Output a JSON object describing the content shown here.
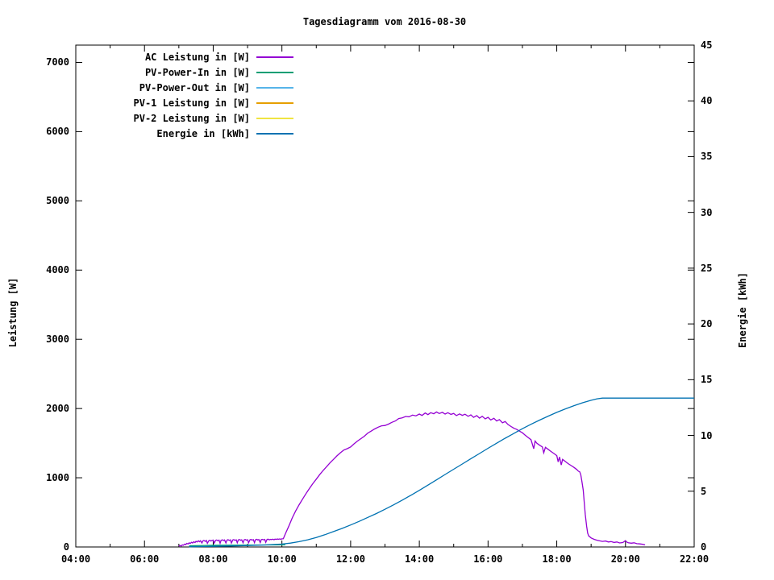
{
  "chart_data": {
    "type": "line",
    "title": "Tagesdiagramm vom 2016-08-30",
    "y1_label": "Leistung [W]",
    "y2_label": "Energie [kWh]",
    "x_range": [
      4,
      22
    ],
    "y1_range": [
      0,
      7250
    ],
    "y2_range": [
      0,
      45
    ],
    "grid": false,
    "legend_position": "top-left-inside",
    "x_ticks": [
      {
        "value": 4,
        "label": "04:00"
      },
      {
        "value": 6,
        "label": "06:00"
      },
      {
        "value": 8,
        "label": "08:00"
      },
      {
        "value": 10,
        "label": "10:00"
      },
      {
        "value": 12,
        "label": "12:00"
      },
      {
        "value": 14,
        "label": "14:00"
      },
      {
        "value": 16,
        "label": "16:00"
      },
      {
        "value": 18,
        "label": "18:00"
      },
      {
        "value": 20,
        "label": "20:00"
      },
      {
        "value": 22,
        "label": "22:00"
      }
    ],
    "x_minor_ticks": [
      5,
      7,
      9,
      11,
      13,
      15,
      17,
      19,
      21
    ],
    "y1_ticks": [
      {
        "value": 0,
        "label": "0"
      },
      {
        "value": 1000,
        "label": "1000"
      },
      {
        "value": 2000,
        "label": "2000"
      },
      {
        "value": 3000,
        "label": "3000"
      },
      {
        "value": 4000,
        "label": "4000"
      },
      {
        "value": 5000,
        "label": "5000"
      },
      {
        "value": 6000,
        "label": "6000"
      },
      {
        "value": 7000,
        "label": "7000"
      }
    ],
    "y2_ticks": [
      {
        "value": 0,
        "label": "0"
      },
      {
        "value": 5,
        "label": "5"
      },
      {
        "value": 10,
        "label": "10"
      },
      {
        "value": 15,
        "label": "15"
      },
      {
        "value": 20,
        "label": "20"
      },
      {
        "value": 25,
        "label": "25"
      },
      {
        "value": 30,
        "label": "30"
      },
      {
        "value": 35,
        "label": "35"
      },
      {
        "value": 40,
        "label": "40"
      },
      {
        "value": 45,
        "label": "45"
      }
    ],
    "series": [
      {
        "name": "ac-leistung",
        "label": "AC Leistung in [W]",
        "color": "#9400d3",
        "axis": "y1",
        "points": [
          [
            7.0,
            10
          ],
          [
            7.03,
            22
          ],
          [
            7.07,
            14
          ],
          [
            7.1,
            30
          ],
          [
            7.13,
            24
          ],
          [
            7.17,
            42
          ],
          [
            7.2,
            34
          ],
          [
            7.23,
            52
          ],
          [
            7.27,
            44
          ],
          [
            7.3,
            60
          ],
          [
            7.33,
            50
          ],
          [
            7.37,
            68
          ],
          [
            7.4,
            58
          ],
          [
            7.43,
            74
          ],
          [
            7.47,
            64
          ],
          [
            7.5,
            82
          ],
          [
            7.53,
            72
          ],
          [
            7.57,
            88
          ],
          [
            7.6,
            76
          ],
          [
            7.63,
            90
          ],
          [
            7.67,
            58
          ],
          [
            7.7,
            88
          ],
          [
            7.73,
            94
          ],
          [
            7.77,
            80
          ],
          [
            7.8,
            94
          ],
          [
            7.83,
            54
          ],
          [
            7.87,
            90
          ],
          [
            7.9,
            98
          ],
          [
            7.93,
            86
          ],
          [
            7.97,
            94
          ],
          [
            8.0,
            99
          ],
          [
            8.03,
            56
          ],
          [
            8.07,
            95
          ],
          [
            8.1,
            101
          ],
          [
            8.13,
            91
          ],
          [
            8.17,
            99
          ],
          [
            8.2,
            54
          ],
          [
            8.23,
            97
          ],
          [
            8.27,
            103
          ],
          [
            8.3,
            93
          ],
          [
            8.33,
            101
          ],
          [
            8.37,
            58
          ],
          [
            8.4,
            99
          ],
          [
            8.43,
            105
          ],
          [
            8.47,
            95
          ],
          [
            8.5,
            102
          ],
          [
            8.53,
            57
          ],
          [
            8.57,
            101
          ],
          [
            8.6,
            106
          ],
          [
            8.63,
            96
          ],
          [
            8.67,
            103
          ],
          [
            8.7,
            60
          ],
          [
            8.73,
            102
          ],
          [
            8.77,
            107
          ],
          [
            8.8,
            97
          ],
          [
            8.83,
            104
          ],
          [
            8.87,
            59
          ],
          [
            8.9,
            103
          ],
          [
            8.93,
            108
          ],
          [
            8.97,
            98
          ],
          [
            9.0,
            105
          ],
          [
            9.03,
            61
          ],
          [
            9.07,
            104
          ],
          [
            9.1,
            109
          ],
          [
            9.13,
            99
          ],
          [
            9.17,
            106
          ],
          [
            9.2,
            63
          ],
          [
            9.23,
            105
          ],
          [
            9.27,
            110
          ],
          [
            9.3,
            100
          ],
          [
            9.33,
            107
          ],
          [
            9.37,
            64
          ],
          [
            9.4,
            107
          ],
          [
            9.43,
            111
          ],
          [
            9.47,
            102
          ],
          [
            9.5,
            109
          ],
          [
            9.53,
            67
          ],
          [
            9.57,
            109
          ],
          [
            9.6,
            113
          ],
          [
            9.63,
            104
          ],
          [
            9.67,
            111
          ],
          [
            9.7,
            107
          ],
          [
            9.73,
            113
          ],
          [
            9.77,
            105
          ],
          [
            9.8,
            114
          ],
          [
            9.83,
            109
          ],
          [
            9.87,
            115
          ],
          [
            9.9,
            111
          ],
          [
            9.93,
            116
          ],
          [
            9.97,
            112
          ],
          [
            10.0,
            117
          ],
          [
            10.04,
            119
          ],
          [
            10.1,
            190
          ],
          [
            10.2,
            300
          ],
          [
            10.3,
            420
          ],
          [
            10.4,
            520
          ],
          [
            10.5,
            610
          ],
          [
            10.6,
            690
          ],
          [
            10.7,
            770
          ],
          [
            10.8,
            845
          ],
          [
            10.9,
            915
          ],
          [
            11.0,
            980
          ],
          [
            11.1,
            1045
          ],
          [
            11.2,
            1105
          ],
          [
            11.3,
            1160
          ],
          [
            11.4,
            1215
          ],
          [
            11.5,
            1265
          ],
          [
            11.6,
            1315
          ],
          [
            11.7,
            1360
          ],
          [
            11.8,
            1400
          ],
          [
            11.9,
            1420
          ],
          [
            12.0,
            1445
          ],
          [
            12.1,
            1490
          ],
          [
            12.2,
            1530
          ],
          [
            12.3,
            1565
          ],
          [
            12.4,
            1600
          ],
          [
            12.5,
            1645
          ],
          [
            12.6,
            1675
          ],
          [
            12.7,
            1705
          ],
          [
            12.8,
            1730
          ],
          [
            12.9,
            1750
          ],
          [
            13.0,
            1755
          ],
          [
            13.1,
            1775
          ],
          [
            13.2,
            1800
          ],
          [
            13.3,
            1820
          ],
          [
            13.4,
            1855
          ],
          [
            13.5,
            1865
          ],
          [
            13.6,
            1885
          ],
          [
            13.7,
            1880
          ],
          [
            13.8,
            1905
          ],
          [
            13.9,
            1895
          ],
          [
            14.0,
            1920
          ],
          [
            14.08,
            1900
          ],
          [
            14.17,
            1935
          ],
          [
            14.25,
            1912
          ],
          [
            14.33,
            1940
          ],
          [
            14.42,
            1925
          ],
          [
            14.5,
            1950
          ],
          [
            14.58,
            1928
          ],
          [
            14.67,
            1945
          ],
          [
            14.75,
            1920
          ],
          [
            14.83,
            1940
          ],
          [
            14.92,
            1915
          ],
          [
            15.0,
            1930
          ],
          [
            15.08,
            1898
          ],
          [
            15.17,
            1922
          ],
          [
            15.25,
            1902
          ],
          [
            15.33,
            1918
          ],
          [
            15.42,
            1888
          ],
          [
            15.5,
            1908
          ],
          [
            15.58,
            1872
          ],
          [
            15.67,
            1898
          ],
          [
            15.75,
            1862
          ],
          [
            15.83,
            1888
          ],
          [
            15.92,
            1850
          ],
          [
            16.0,
            1872
          ],
          [
            16.08,
            1835
          ],
          [
            16.17,
            1858
          ],
          [
            16.25,
            1820
          ],
          [
            16.33,
            1840
          ],
          [
            16.42,
            1795
          ],
          [
            16.5,
            1812
          ],
          [
            16.58,
            1770
          ],
          [
            16.67,
            1740
          ],
          [
            16.75,
            1715
          ],
          [
            16.83,
            1700
          ],
          [
            16.92,
            1672
          ],
          [
            17.0,
            1650
          ],
          [
            17.08,
            1615
          ],
          [
            17.17,
            1580
          ],
          [
            17.25,
            1550
          ],
          [
            17.33,
            1420
          ],
          [
            17.37,
            1530
          ],
          [
            17.42,
            1500
          ],
          [
            17.5,
            1470
          ],
          [
            17.58,
            1445
          ],
          [
            17.62,
            1360
          ],
          [
            17.67,
            1440
          ],
          [
            17.75,
            1410
          ],
          [
            17.83,
            1380
          ],
          [
            17.92,
            1350
          ],
          [
            18.0,
            1320
          ],
          [
            18.04,
            1230
          ],
          [
            18.08,
            1300
          ],
          [
            18.13,
            1185
          ],
          [
            18.17,
            1265
          ],
          [
            18.25,
            1235
          ],
          [
            18.33,
            1205
          ],
          [
            18.42,
            1175
          ],
          [
            18.5,
            1150
          ],
          [
            18.58,
            1120
          ],
          [
            18.63,
            1095
          ],
          [
            18.67,
            1085
          ],
          [
            18.7,
            1040
          ],
          [
            18.73,
            950
          ],
          [
            18.77,
            820
          ],
          [
            18.8,
            650
          ],
          [
            18.83,
            470
          ],
          [
            18.87,
            300
          ],
          [
            18.9,
            200
          ],
          [
            18.93,
            160
          ],
          [
            19.0,
            130
          ],
          [
            19.08,
            112
          ],
          [
            19.17,
            98
          ],
          [
            19.25,
            88
          ],
          [
            19.33,
            80
          ],
          [
            19.42,
            86
          ],
          [
            19.5,
            72
          ],
          [
            19.58,
            78
          ],
          [
            19.67,
            65
          ],
          [
            19.75,
            72
          ],
          [
            19.83,
            58
          ],
          [
            19.92,
            64
          ],
          [
            20.0,
            92
          ],
          [
            20.04,
            70
          ],
          [
            20.08,
            60
          ],
          [
            20.17,
            55
          ],
          [
            20.25,
            60
          ],
          [
            20.33,
            48
          ],
          [
            20.42,
            44
          ],
          [
            20.5,
            38
          ],
          [
            20.57,
            30
          ]
        ]
      },
      {
        "name": "pv-power-in",
        "label": "PV-Power-In in [W]",
        "color": "#009e73",
        "axis": "y1",
        "points": [
          [
            7.3,
            18
          ],
          [
            8.0,
            24
          ],
          [
            9.0,
            28
          ],
          [
            10.1,
            30
          ]
        ]
      },
      {
        "name": "pv-power-out",
        "label": "PV-Power-Out in [W]",
        "color": "#56b4e9",
        "axis": "y1",
        "points": []
      },
      {
        "name": "pv1-leistung",
        "label": "PV-1 Leistung in [W]",
        "color": "#e69f00",
        "axis": "y1",
        "points": []
      },
      {
        "name": "pv2-leistung",
        "label": "PV-2 Leistung in [W]",
        "color": "#f0e442",
        "axis": "y1",
        "points": []
      },
      {
        "name": "energie",
        "label": "Energie in [kWh]",
        "color": "#0072b2",
        "axis": "y2",
        "points": [
          [
            7.3,
            0.02
          ],
          [
            8.0,
            0.06
          ],
          [
            8.5,
            0.09
          ],
          [
            9.0,
            0.13
          ],
          [
            9.5,
            0.18
          ],
          [
            10.0,
            0.26
          ],
          [
            10.25,
            0.35
          ],
          [
            10.5,
            0.48
          ],
          [
            10.75,
            0.64
          ],
          [
            11.0,
            0.85
          ],
          [
            11.25,
            1.1
          ],
          [
            11.5,
            1.38
          ],
          [
            11.75,
            1.66
          ],
          [
            12.0,
            1.97
          ],
          [
            12.25,
            2.3
          ],
          [
            12.5,
            2.65
          ],
          [
            12.75,
            3.0
          ],
          [
            13.0,
            3.38
          ],
          [
            13.25,
            3.78
          ],
          [
            13.5,
            4.2
          ],
          [
            13.75,
            4.63
          ],
          [
            14.0,
            5.08
          ],
          [
            14.25,
            5.55
          ],
          [
            14.5,
            6.02
          ],
          [
            14.75,
            6.5
          ],
          [
            15.0,
            6.97
          ],
          [
            15.25,
            7.44
          ],
          [
            15.5,
            7.92
          ],
          [
            15.75,
            8.38
          ],
          [
            16.0,
            8.85
          ],
          [
            16.25,
            9.3
          ],
          [
            16.5,
            9.75
          ],
          [
            16.75,
            10.18
          ],
          [
            17.0,
            10.6
          ],
          [
            17.25,
            11.0
          ],
          [
            17.5,
            11.38
          ],
          [
            17.75,
            11.73
          ],
          [
            18.0,
            12.07
          ],
          [
            18.25,
            12.38
          ],
          [
            18.5,
            12.67
          ],
          [
            18.75,
            12.93
          ],
          [
            19.0,
            13.15
          ],
          [
            19.17,
            13.28
          ],
          [
            19.33,
            13.35
          ],
          [
            22.0,
            13.35
          ]
        ]
      }
    ]
  }
}
